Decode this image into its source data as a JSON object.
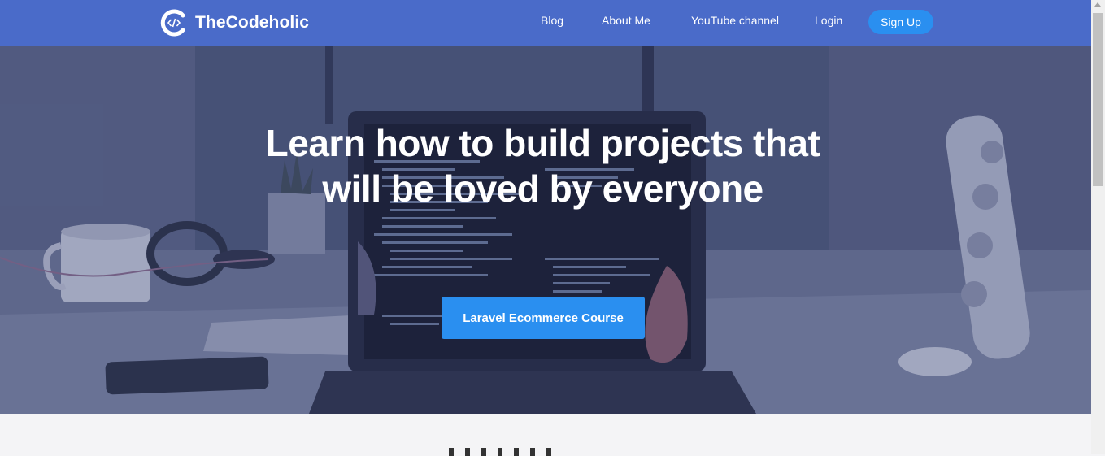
{
  "brand": {
    "name": "TheCodeholic",
    "logo_icon": "code-brackets-logo-icon"
  },
  "nav": {
    "links": [
      "Blog",
      "About Me",
      "YouTube channel",
      "Login"
    ],
    "signup": "Sign Up"
  },
  "hero": {
    "title": "Learn how to build projects that will be loved by everyone",
    "cta": "Laravel Ecommerce Course"
  },
  "colors": {
    "navbar": "#4a6bc9",
    "accent": "#2a8ff0",
    "hero_overlay": "#3a4678"
  }
}
